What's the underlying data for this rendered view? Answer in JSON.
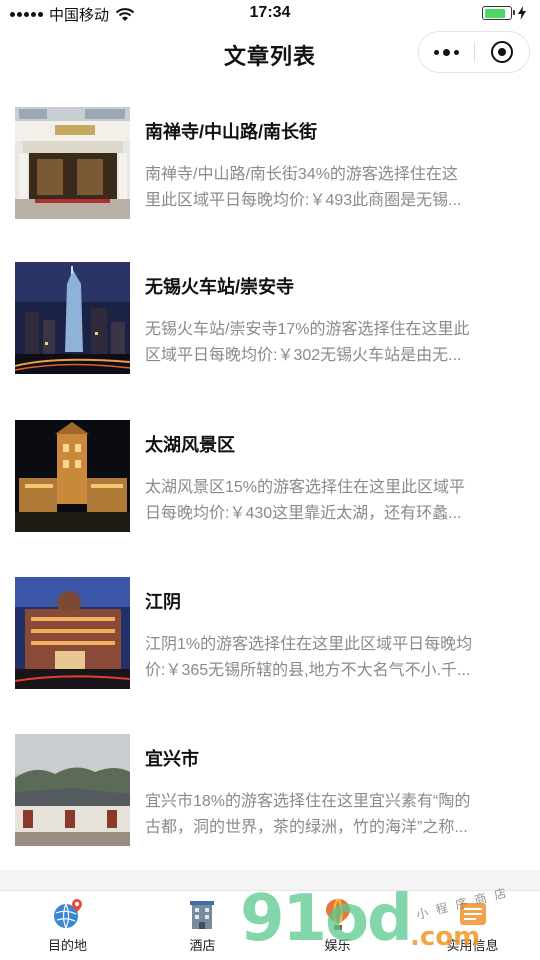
{
  "status_bar": {
    "carrier": "中国移动",
    "time": "17:34",
    "battery_level": 0.8,
    "battery_color": "#4cd964"
  },
  "nav": {
    "title": "文章列表",
    "more_icon": "more-dots-icon",
    "close_icon": "target-circle-icon"
  },
  "articles": [
    {
      "title": "南禅寺/中山路/南长街",
      "desc_line1": "南禅寺/中山路/南长街34%的游客选择住在这",
      "desc_line2": "里此区域平日每晚均价:￥493此商圈是无锡...",
      "thumbnail": "hotel-entrance-photo"
    },
    {
      "title": "无锡火车站/崇安寺",
      "desc_line1": "无锡火车站/崇安寺17%的游客选择住在这里此",
      "desc_line2": "区域平日每晚均价:￥302无锡火车站是由无...",
      "thumbnail": "city-night-skyline-photo"
    },
    {
      "title": "太湖风景区",
      "desc_line1": "太湖风景区15%的游客选择住在这里此区域平",
      "desc_line2": "日每晚均价:￥430这里靠近太湖，还有环蠡...",
      "thumbnail": "lit-tower-building-photo"
    },
    {
      "title": "江阴",
      "desc_line1": "江阴1%的游客选择住在这里此区域平日每晚均",
      "desc_line2": "价:￥365无锡所辖的县,地方不大名气不小.千...",
      "thumbnail": "hotel-at-dusk-photo"
    },
    {
      "title": "宜兴市",
      "desc_line1": "宜兴市18%的游客选择住在这里宜兴素有“陶的",
      "desc_line2": "古都，洞的世界，茶的绿洲，竹的海洋”之称...",
      "thumbnail": "old-town-houses-photo"
    }
  ],
  "tabs": [
    {
      "label": "目的地",
      "icon": "globe-pin-icon"
    },
    {
      "label": "酒店",
      "icon": "hotel-building-icon"
    },
    {
      "label": "娱乐",
      "icon": "balloon-icon"
    },
    {
      "label": "实用信息",
      "icon": "info-icon"
    }
  ],
  "watermark": {
    "main": "91od",
    "suffix": ".com",
    "small": "小程序商店"
  }
}
